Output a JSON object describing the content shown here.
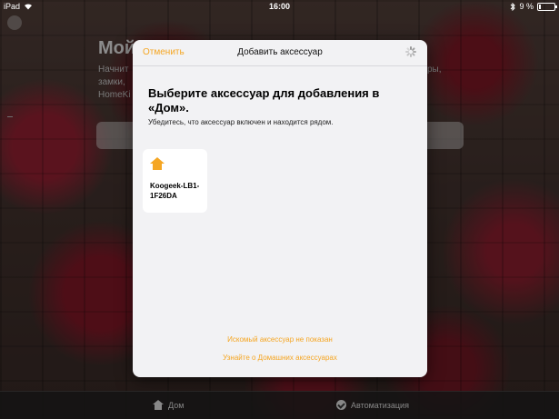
{
  "statusbar": {
    "device": "iPad",
    "time": "16:00",
    "battery": "9 %"
  },
  "background_app": {
    "title_fragment": "Мой",
    "text_fragments": [
      "Начнит",
      "замки, ",
      "HomeKi"
    ],
    "text_right_fragment": "ры,"
  },
  "modal": {
    "cancel_label": "Отменить",
    "title": "Добавить аксессуар",
    "heading": "Выберите аксессуар для добавления в «Дом».",
    "subheading": "Убедитесь, что аксессуар включен и находится рядом.",
    "accessories": [
      {
        "name": "Koogeek-LB1-1F26DA",
        "icon": "house-icon"
      }
    ],
    "link_not_shown": "Искомый аксессуар не показан",
    "link_learn": "Узнайте о Домашних аксессуарах"
  },
  "tabbar": {
    "home_label": "Дом",
    "automation_label": "Автоматизация"
  },
  "colors": {
    "accent": "#f5a623"
  }
}
